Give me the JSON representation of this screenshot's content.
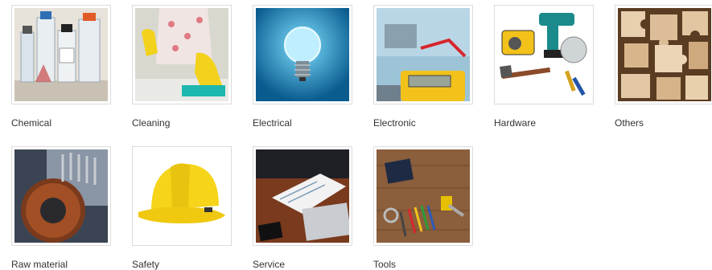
{
  "categories": [
    {
      "label": "Chemical",
      "icon": "lab-bottles-image"
    },
    {
      "label": "Cleaning",
      "icon": "cleaning-gloves-image"
    },
    {
      "label": "Electrical",
      "icon": "light-bulb-image"
    },
    {
      "label": "Electronic",
      "icon": "multimeter-image"
    },
    {
      "label": "Hardware",
      "icon": "power-tools-image"
    },
    {
      "label": "Others",
      "icon": "puzzle-pieces-image"
    },
    {
      "label": "Raw material",
      "icon": "gear-image"
    },
    {
      "label": "Safety",
      "icon": "hard-hat-image"
    },
    {
      "label": "Service",
      "icon": "documents-laptop-image"
    },
    {
      "label": "Tools",
      "icon": "hand-tools-image"
    }
  ]
}
